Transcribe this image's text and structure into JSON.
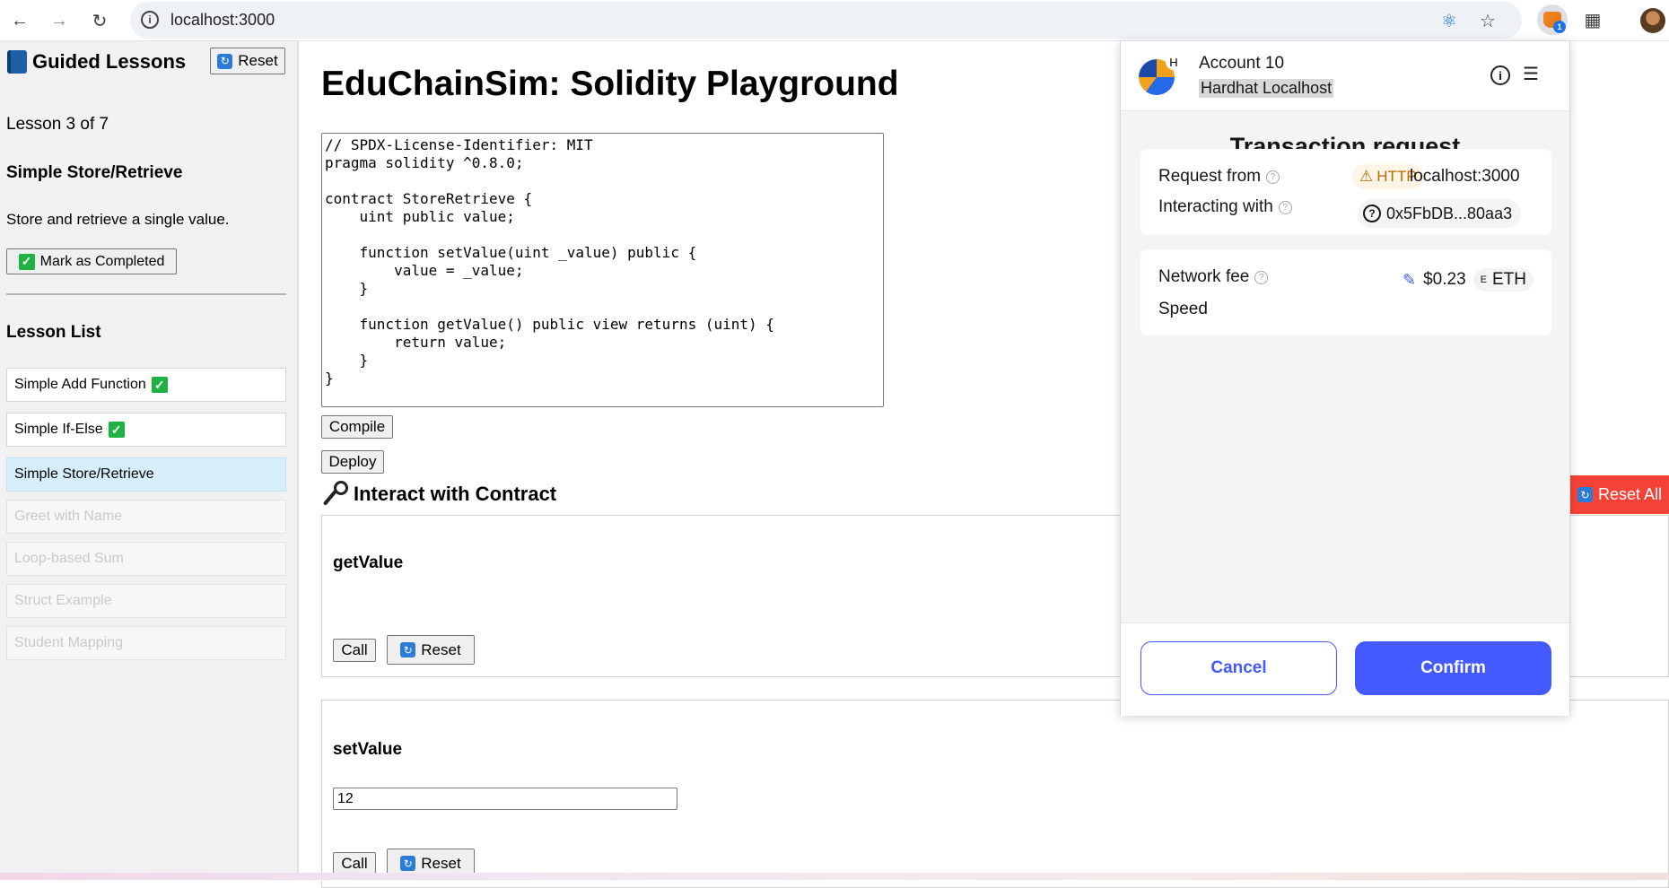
{
  "browser": {
    "url": "localhost:3000",
    "extension_badge": "1",
    "icons": [
      "back-icon",
      "forward-icon",
      "reload-icon",
      "site-info-icon",
      "react-devtools-icon",
      "bookmark-star-icon",
      "metamask-icon",
      "extensions-icon",
      "profile-avatar"
    ]
  },
  "sidebar": {
    "title": "Guided Lessons",
    "reset_label": "Reset",
    "progress": "Lesson 3 of 7",
    "current_lesson_title": "Simple Store/Retrieve",
    "current_lesson_desc": "Store and retrieve a single value.",
    "mark_completed_label": "Mark as Completed",
    "lesson_list_title": "Lesson List",
    "lessons": [
      {
        "label": "Simple Add Function",
        "status": "completed"
      },
      {
        "label": "Simple If-Else",
        "status": "completed"
      },
      {
        "label": "Simple Store/Retrieve",
        "status": "active"
      },
      {
        "label": "Greet with Name",
        "status": "locked"
      },
      {
        "label": "Loop-based Sum",
        "status": "locked"
      },
      {
        "label": "Struct Example",
        "status": "locked"
      },
      {
        "label": "Student Mapping",
        "status": "locked"
      }
    ]
  },
  "main": {
    "title": "EduChainSim: Solidity Playground",
    "code": "// SPDX-License-Identifier: MIT\npragma solidity ^0.8.0;\n\ncontract StoreRetrieve {\n    uint public value;\n\n    function setValue(uint _value) public {\n        value = _value;\n    }\n\n    function getValue() public view returns (uint) {\n        return value;\n    }\n}",
    "compile_label": "Compile",
    "deploy_label": "Deploy",
    "interact_title": "Interact with Contract",
    "reset_all_label": "Reset All",
    "functions": [
      {
        "name": "getValue",
        "call_label": "Call",
        "reset_label": "Reset"
      },
      {
        "name": "setValue",
        "input_value": "12",
        "call_label": "Call",
        "reset_label": "Reset"
      }
    ]
  },
  "metamask": {
    "account_name": "Account 10",
    "network_letter": "H",
    "network_name": "Hardhat Localhost",
    "title": "Transaction request",
    "request_from_label": "Request from",
    "http_label": "HTTP",
    "request_host": "localhost:3000",
    "interacting_with_label": "Interacting with",
    "contract_address": "0x5FbDB...80aa3",
    "network_fee_label": "Network fee",
    "fee_value": "$0.23",
    "fee_currency": "ETH",
    "fee_currency_letter": "E",
    "speed_label": "Speed",
    "cancel_label": "Cancel",
    "confirm_label": "Confirm",
    "accent_color": "#4459ff"
  }
}
